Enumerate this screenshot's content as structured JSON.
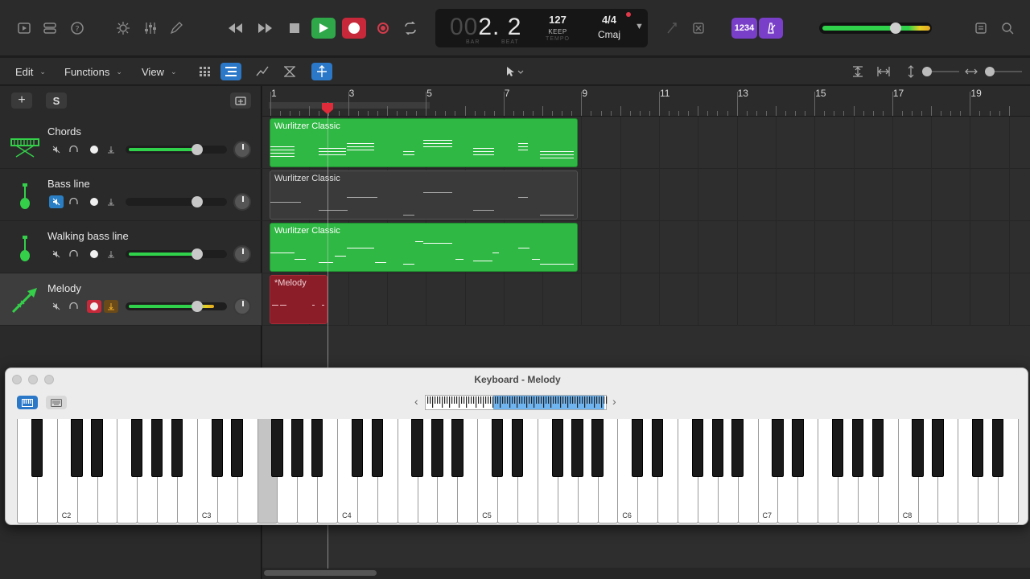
{
  "lcd": {
    "position_dim": "00",
    "position": "2. 2",
    "bar_label": "BAR",
    "beat_label": "BEAT",
    "tempo": "127",
    "tempo_mode": "KEEP",
    "tempo_label": "TEMPO",
    "time_signature": "4/4",
    "key": "Cmaj"
  },
  "control_bar": {
    "count_in_label": "1234"
  },
  "toolbar": {
    "edit_menu": "Edit",
    "functions_menu": "Functions",
    "view_menu": "View"
  },
  "track_header": {
    "add_label": "+",
    "solo_label": "S"
  },
  "tracks": [
    {
      "name": "Chords",
      "muted": false,
      "armed": false
    },
    {
      "name": "Bass line",
      "muted": true,
      "armed": false
    },
    {
      "name": "Walking bass line",
      "muted": false,
      "armed": false
    },
    {
      "name": "Melody",
      "muted": false,
      "armed": true
    }
  ],
  "ruler": {
    "bars": [
      "1",
      "3",
      "5",
      "7",
      "9",
      "11",
      "13",
      "15",
      "17",
      "19"
    ]
  },
  "regions": [
    {
      "label": "Wurlitzer Classic",
      "color": "#2fb843"
    },
    {
      "label": "Wurlitzer Classic",
      "color": "#3a3a3a"
    },
    {
      "label": "Wurlitzer Classic",
      "color": "#2fb843"
    },
    {
      "label": "*Melody",
      "color": "#8a1d28"
    }
  ],
  "keyboard_window": {
    "title": "Keyboard - Melody",
    "octave_labels": [
      "C2",
      "C3",
      "C4",
      "C5",
      "C6",
      "C7",
      "C8"
    ]
  },
  "colors": {
    "accent_blue": "#2b78c8",
    "track_green": "#2fb843",
    "record_red": "#c8293a",
    "purple": "#7a3fc9"
  }
}
